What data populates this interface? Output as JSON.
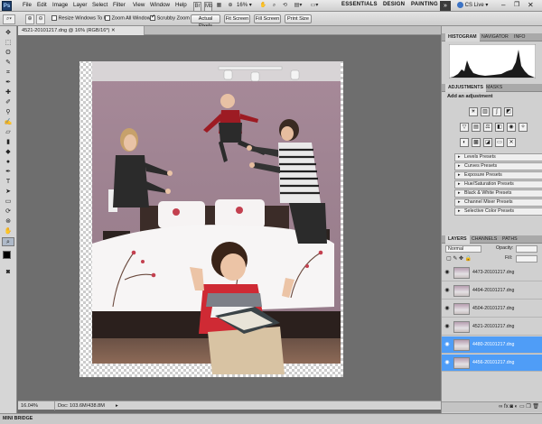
{
  "menubar": {
    "app_icon": "Ps",
    "items": [
      "File",
      "Edit",
      "Image",
      "Layer",
      "Select",
      "Filter",
      "View",
      "Window",
      "Help"
    ],
    "zoom_value": "16",
    "workspaces": [
      "ESSENTIALS",
      "DESIGN",
      "PAINTING"
    ],
    "expand": "»",
    "cs_live": "CS Live"
  },
  "options": {
    "resize_windows": "Resize Windows To Fit",
    "zoom_all": "Zoom All Windows",
    "scrubby_zoom": "Scrubby Zoom",
    "actual_pixels": "Actual Pixels",
    "fit_screen": "Fit Screen",
    "fill_screen": "Fill Screen",
    "print_size": "Print Size"
  },
  "document": {
    "tab_title": "4521-20101217.dng @ 16% (RGB/16*)",
    "zoom": "16.04%",
    "doc_info": "Doc: 103.6M/438.8M"
  },
  "panels": {
    "histogram_tab": "HISTOGRAM",
    "navigator_tab": "NAVIGATOR",
    "info_tab": "INFO",
    "adjustments_tab": "ADJUSTMENTS",
    "masks_tab": "MASKS",
    "add_adjustment": "Add an adjustment",
    "presets": [
      "Levels Presets",
      "Curves Presets",
      "Exposure Presets",
      "Hue/Saturation Presets",
      "Black & White Presets",
      "Channel Mixer Presets",
      "Selective Color Presets"
    ],
    "layers_tab": "LAYERS",
    "channels_tab": "CHANNELS",
    "paths_tab": "PATHS",
    "blend_mode": "Normal",
    "opacity_label": "Opacity:",
    "fill_label": "Fill:",
    "layers": [
      {
        "name": "4473-20101217.dng",
        "selected": false
      },
      {
        "name": "4494-20101217.dng",
        "selected": false
      },
      {
        "name": "4504-20101217.dng",
        "selected": false
      },
      {
        "name": "4521-20101217.dng",
        "selected": false
      },
      {
        "name": "4480-20101217.dng",
        "selected": true
      },
      {
        "name": "4456-20101217.dng",
        "selected": true
      }
    ]
  },
  "minibridge": "MINI BRIDGE",
  "icons": [
    "search-icon",
    "zoom-in-icon",
    "zoom-out-icon",
    "hand-icon",
    "eye-icon",
    "histogram-icon"
  ]
}
